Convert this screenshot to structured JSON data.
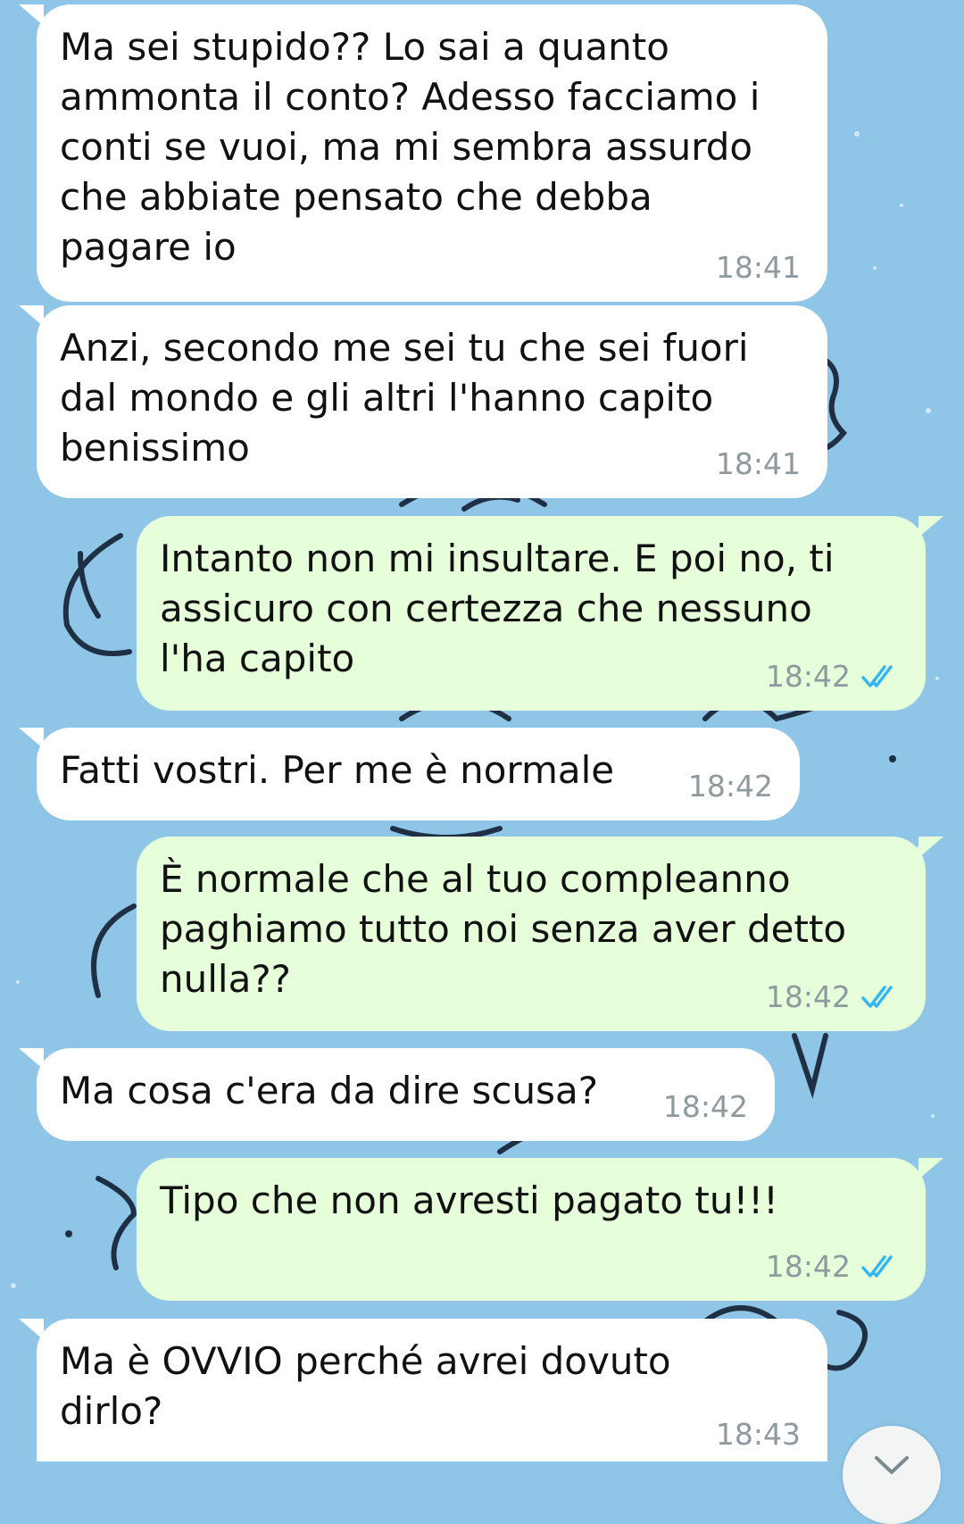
{
  "messages": [
    {
      "direction": "incoming",
      "text": "Ma sei stupido?? Lo sai a quanto\nammonta il conto? Adesso facciamo i\nconti se vuoi, ma mi sembra assurdo\nche abbiate pensato che debba\npagare io",
      "time": "18:41"
    },
    {
      "direction": "incoming",
      "text": "Anzi, secondo me sei tu che sei fuori\ndal mondo e gli altri l'hanno capito\nbenissimo",
      "time": "18:41"
    },
    {
      "direction": "outgoing",
      "text": "Intanto non mi insultare. E poi no, ti\nassicuro con certezza che nessuno\nl'ha capito",
      "time": "18:42",
      "status": "read"
    },
    {
      "direction": "incoming",
      "text": "Fatti vostri. Per me è normale",
      "time": "18:42"
    },
    {
      "direction": "outgoing",
      "text": "È normale che al tuo compleanno\npaghiamo tutto noi senza aver detto\nnulla??",
      "time": "18:42",
      "status": "read"
    },
    {
      "direction": "incoming",
      "text": "Ma cosa c'era da dire scusa?",
      "time": "18:42"
    },
    {
      "direction": "outgoing",
      "text": "Tipo che non avresti pagato tu!!!",
      "time": "18:42",
      "status": "read"
    },
    {
      "direction": "incoming",
      "text": "Ma è OVVIO perché avrei dovuto\ndirlo?",
      "time": "18:43"
    }
  ],
  "colors": {
    "wallpaper": "#8fc6e8",
    "incoming_bubble": "#ffffff",
    "outgoing_bubble": "#e6ffda",
    "read_ticks": "#34b7f1",
    "timestamp": "#8f9aa0"
  },
  "icons": {
    "read_status": "double-check-icon",
    "scroll_down": "chevron-down-icon"
  }
}
